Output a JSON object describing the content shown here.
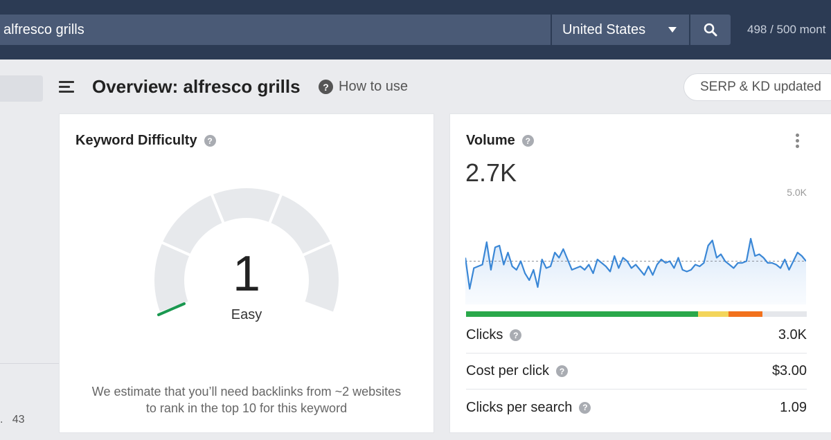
{
  "topbar": {
    "search_value": "alfresco grills",
    "country": "United States",
    "credits": "498 / 500 mont"
  },
  "header": {
    "title": "Overview: alfresco grills",
    "how_to": "How to use",
    "serp_status": "SERP & KD updated"
  },
  "left": {
    "stub_number": ".   43"
  },
  "kd_card": {
    "title": "Keyword Difficulty",
    "value": "1",
    "label": "Easy",
    "description_line1": "We estimate that you’ll need backlinks from ~2 websites",
    "description_line2": "to rank in the top 10 for this keyword",
    "gauge_fill_fraction": 0.01,
    "gauge_color": "#1a9850"
  },
  "volume_card": {
    "title": "Volume",
    "value": "2.7K",
    "axis_max_label": "5.0K",
    "line_color": "#3a87d6",
    "trend": [
      2.7,
      0.9,
      2.1,
      2.2,
      2.3,
      3.6,
      2.0,
      3.3,
      3.4,
      2.3,
      3.0,
      2.2,
      2.0,
      2.5,
      1.8,
      1.4,
      2.0,
      1.0,
      2.6,
      2.1,
      2.2,
      3.0,
      2.7,
      3.2,
      2.6,
      2.0,
      2.1,
      2.2,
      2.0,
      2.3,
      1.8,
      2.6,
      2.4,
      2.2,
      1.9,
      2.8,
      2.1,
      2.7,
      2.5,
      2.1,
      2.3,
      2.0,
      1.7,
      2.2,
      1.7,
      2.3,
      2.6,
      2.4,
      2.5,
      2.1,
      2.7,
      2.0,
      1.9,
      2.0,
      2.3,
      2.2,
      2.4,
      3.4,
      3.7,
      2.7,
      2.9,
      2.5,
      2.3,
      2.1,
      2.4,
      2.4,
      2.5,
      3.8,
      2.8,
      2.9,
      2.7,
      2.4,
      2.4,
      2.3,
      2.1,
      2.6,
      2.0,
      2.5,
      3.0,
      2.8,
      2.5
    ],
    "trend_avg": 2.5,
    "share_bar": [
      {
        "name": "organic",
        "fraction": 0.68,
        "color": "#2aa84a"
      },
      {
        "name": "paid-low",
        "fraction": 0.09,
        "color": "#f3d55b"
      },
      {
        "name": "paid-high",
        "fraction": 0.1,
        "color": "#f2711c"
      },
      {
        "name": "no-clicks",
        "fraction": 0.13,
        "color": "#e5e7eb"
      }
    ],
    "metrics": [
      {
        "label": "Clicks",
        "value": "3.0K"
      },
      {
        "label": "Cost per click",
        "value": "$3.00"
      },
      {
        "label": "Clicks per search",
        "value": "1.09"
      }
    ]
  }
}
